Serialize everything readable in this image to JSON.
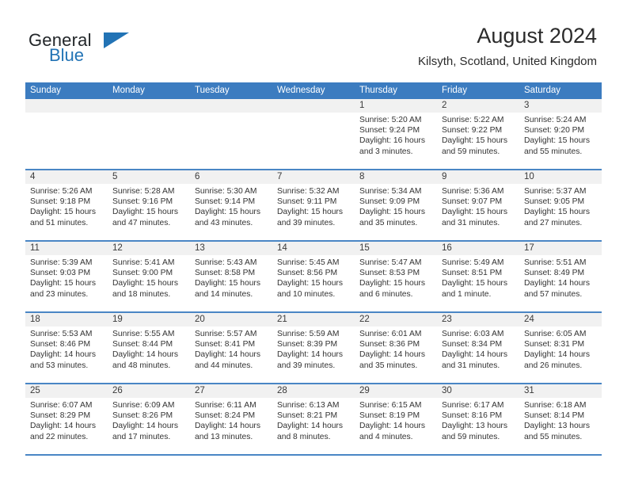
{
  "brand": {
    "name_top": "General",
    "name_bottom": "Blue",
    "accent_color": "#2273b5"
  },
  "header": {
    "title": "August 2024",
    "subtitle": "Kilsyth, Scotland, United Kingdom"
  },
  "calendar": {
    "header_bg": "#3c7cc0",
    "row_divider_color": "#4a86c5",
    "daynum_bg": "#f1f1f1",
    "weekdays": [
      "Sunday",
      "Monday",
      "Tuesday",
      "Wednesday",
      "Thursday",
      "Friday",
      "Saturday"
    ],
    "weeks": [
      [
        {
          "day": "",
          "sunrise": "",
          "sunset": "",
          "daylight1": "",
          "daylight2": ""
        },
        {
          "day": "",
          "sunrise": "",
          "sunset": "",
          "daylight1": "",
          "daylight2": ""
        },
        {
          "day": "",
          "sunrise": "",
          "sunset": "",
          "daylight1": "",
          "daylight2": ""
        },
        {
          "day": "",
          "sunrise": "",
          "sunset": "",
          "daylight1": "",
          "daylight2": ""
        },
        {
          "day": "1",
          "sunrise": "Sunrise: 5:20 AM",
          "sunset": "Sunset: 9:24 PM",
          "daylight1": "Daylight: 16 hours",
          "daylight2": "and 3 minutes."
        },
        {
          "day": "2",
          "sunrise": "Sunrise: 5:22 AM",
          "sunset": "Sunset: 9:22 PM",
          "daylight1": "Daylight: 15 hours",
          "daylight2": "and 59 minutes."
        },
        {
          "day": "3",
          "sunrise": "Sunrise: 5:24 AM",
          "sunset": "Sunset: 9:20 PM",
          "daylight1": "Daylight: 15 hours",
          "daylight2": "and 55 minutes."
        }
      ],
      [
        {
          "day": "4",
          "sunrise": "Sunrise: 5:26 AM",
          "sunset": "Sunset: 9:18 PM",
          "daylight1": "Daylight: 15 hours",
          "daylight2": "and 51 minutes."
        },
        {
          "day": "5",
          "sunrise": "Sunrise: 5:28 AM",
          "sunset": "Sunset: 9:16 PM",
          "daylight1": "Daylight: 15 hours",
          "daylight2": "and 47 minutes."
        },
        {
          "day": "6",
          "sunrise": "Sunrise: 5:30 AM",
          "sunset": "Sunset: 9:14 PM",
          "daylight1": "Daylight: 15 hours",
          "daylight2": "and 43 minutes."
        },
        {
          "day": "7",
          "sunrise": "Sunrise: 5:32 AM",
          "sunset": "Sunset: 9:11 PM",
          "daylight1": "Daylight: 15 hours",
          "daylight2": "and 39 minutes."
        },
        {
          "day": "8",
          "sunrise": "Sunrise: 5:34 AM",
          "sunset": "Sunset: 9:09 PM",
          "daylight1": "Daylight: 15 hours",
          "daylight2": "and 35 minutes."
        },
        {
          "day": "9",
          "sunrise": "Sunrise: 5:36 AM",
          "sunset": "Sunset: 9:07 PM",
          "daylight1": "Daylight: 15 hours",
          "daylight2": "and 31 minutes."
        },
        {
          "day": "10",
          "sunrise": "Sunrise: 5:37 AM",
          "sunset": "Sunset: 9:05 PM",
          "daylight1": "Daylight: 15 hours",
          "daylight2": "and 27 minutes."
        }
      ],
      [
        {
          "day": "11",
          "sunrise": "Sunrise: 5:39 AM",
          "sunset": "Sunset: 9:03 PM",
          "daylight1": "Daylight: 15 hours",
          "daylight2": "and 23 minutes."
        },
        {
          "day": "12",
          "sunrise": "Sunrise: 5:41 AM",
          "sunset": "Sunset: 9:00 PM",
          "daylight1": "Daylight: 15 hours",
          "daylight2": "and 18 minutes."
        },
        {
          "day": "13",
          "sunrise": "Sunrise: 5:43 AM",
          "sunset": "Sunset: 8:58 PM",
          "daylight1": "Daylight: 15 hours",
          "daylight2": "and 14 minutes."
        },
        {
          "day": "14",
          "sunrise": "Sunrise: 5:45 AM",
          "sunset": "Sunset: 8:56 PM",
          "daylight1": "Daylight: 15 hours",
          "daylight2": "and 10 minutes."
        },
        {
          "day": "15",
          "sunrise": "Sunrise: 5:47 AM",
          "sunset": "Sunset: 8:53 PM",
          "daylight1": "Daylight: 15 hours",
          "daylight2": "and 6 minutes."
        },
        {
          "day": "16",
          "sunrise": "Sunrise: 5:49 AM",
          "sunset": "Sunset: 8:51 PM",
          "daylight1": "Daylight: 15 hours",
          "daylight2": "and 1 minute."
        },
        {
          "day": "17",
          "sunrise": "Sunrise: 5:51 AM",
          "sunset": "Sunset: 8:49 PM",
          "daylight1": "Daylight: 14 hours",
          "daylight2": "and 57 minutes."
        }
      ],
      [
        {
          "day": "18",
          "sunrise": "Sunrise: 5:53 AM",
          "sunset": "Sunset: 8:46 PM",
          "daylight1": "Daylight: 14 hours",
          "daylight2": "and 53 minutes."
        },
        {
          "day": "19",
          "sunrise": "Sunrise: 5:55 AM",
          "sunset": "Sunset: 8:44 PM",
          "daylight1": "Daylight: 14 hours",
          "daylight2": "and 48 minutes."
        },
        {
          "day": "20",
          "sunrise": "Sunrise: 5:57 AM",
          "sunset": "Sunset: 8:41 PM",
          "daylight1": "Daylight: 14 hours",
          "daylight2": "and 44 minutes."
        },
        {
          "day": "21",
          "sunrise": "Sunrise: 5:59 AM",
          "sunset": "Sunset: 8:39 PM",
          "daylight1": "Daylight: 14 hours",
          "daylight2": "and 39 minutes."
        },
        {
          "day": "22",
          "sunrise": "Sunrise: 6:01 AM",
          "sunset": "Sunset: 8:36 PM",
          "daylight1": "Daylight: 14 hours",
          "daylight2": "and 35 minutes."
        },
        {
          "day": "23",
          "sunrise": "Sunrise: 6:03 AM",
          "sunset": "Sunset: 8:34 PM",
          "daylight1": "Daylight: 14 hours",
          "daylight2": "and 31 minutes."
        },
        {
          "day": "24",
          "sunrise": "Sunrise: 6:05 AM",
          "sunset": "Sunset: 8:31 PM",
          "daylight1": "Daylight: 14 hours",
          "daylight2": "and 26 minutes."
        }
      ],
      [
        {
          "day": "25",
          "sunrise": "Sunrise: 6:07 AM",
          "sunset": "Sunset: 8:29 PM",
          "daylight1": "Daylight: 14 hours",
          "daylight2": "and 22 minutes."
        },
        {
          "day": "26",
          "sunrise": "Sunrise: 6:09 AM",
          "sunset": "Sunset: 8:26 PM",
          "daylight1": "Daylight: 14 hours",
          "daylight2": "and 17 minutes."
        },
        {
          "day": "27",
          "sunrise": "Sunrise: 6:11 AM",
          "sunset": "Sunset: 8:24 PM",
          "daylight1": "Daylight: 14 hours",
          "daylight2": "and 13 minutes."
        },
        {
          "day": "28",
          "sunrise": "Sunrise: 6:13 AM",
          "sunset": "Sunset: 8:21 PM",
          "daylight1": "Daylight: 14 hours",
          "daylight2": "and 8 minutes."
        },
        {
          "day": "29",
          "sunrise": "Sunrise: 6:15 AM",
          "sunset": "Sunset: 8:19 PM",
          "daylight1": "Daylight: 14 hours",
          "daylight2": "and 4 minutes."
        },
        {
          "day": "30",
          "sunrise": "Sunrise: 6:17 AM",
          "sunset": "Sunset: 8:16 PM",
          "daylight1": "Daylight: 13 hours",
          "daylight2": "and 59 minutes."
        },
        {
          "day": "31",
          "sunrise": "Sunrise: 6:18 AM",
          "sunset": "Sunset: 8:14 PM",
          "daylight1": "Daylight: 13 hours",
          "daylight2": "and 55 minutes."
        }
      ]
    ]
  }
}
